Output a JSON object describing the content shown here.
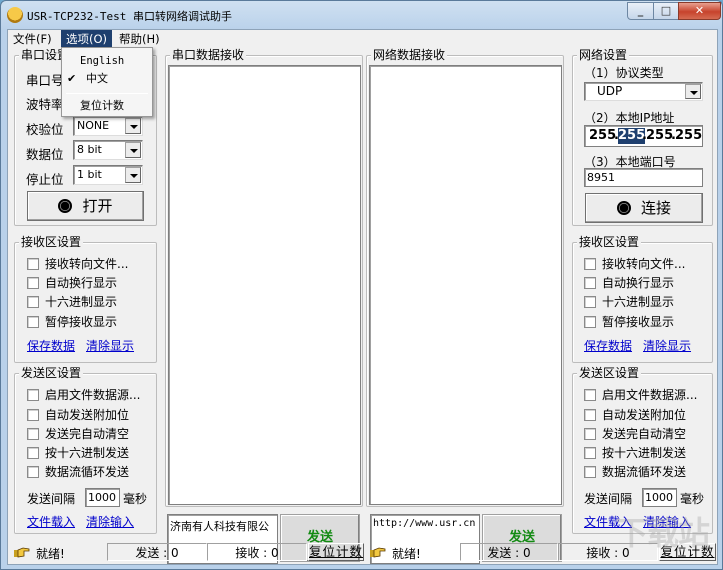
{
  "window": {
    "title": "USR-TCP232-Test  串口转网络调试助手",
    "controls": {
      "minimize": "_",
      "maximize": "□",
      "close": "✕"
    }
  },
  "menubar": {
    "items": [
      {
        "label": "文件(F)"
      },
      {
        "label": "选项(O)"
      },
      {
        "label": "帮助(H)"
      }
    ]
  },
  "options_menu": {
    "items": [
      {
        "label": "English",
        "checked": false
      },
      {
        "label": "中文",
        "checked": true,
        "check_glyph": "✔"
      },
      {
        "label": "复位计数",
        "checked": false
      }
    ]
  },
  "serial_settings": {
    "title": "串口设置",
    "port_label": "串口号",
    "baud_label": "波特率",
    "parity_label": "校验位",
    "parity_value": "NONE",
    "databits_label": "数据位",
    "databits_value": "8 bit",
    "stopbits_label": "停止位",
    "stopbits_value": "1 bit",
    "open_button": "打开"
  },
  "left_receive_settings": {
    "title": "接收区设置",
    "options": [
      "接收转向文件...",
      "自动换行显示",
      "十六进制显示",
      "暂停接收显示"
    ],
    "save_link": "保存数据",
    "clear_link": "清除显示"
  },
  "left_send_settings": {
    "title": "发送区设置",
    "options": [
      "启用文件数据源...",
      "自动发送附加位",
      "发送完自动清空",
      "按十六进制发送",
      "数据流循环发送"
    ],
    "interval_label": "发送间隔",
    "interval_value": "1000",
    "interval_unit": "毫秒",
    "load_link": "文件载入",
    "clear_link": "清除输入"
  },
  "serial_receive": {
    "title": "串口数据接收",
    "content": ""
  },
  "serial_send": {
    "text": "济南有人科技有限公",
    "send_button": "发送"
  },
  "network_receive": {
    "title": "网络数据接收",
    "content": ""
  },
  "network_send": {
    "text": "http://www.usr.cn",
    "send_button": "发送"
  },
  "network_settings": {
    "title": "网络设置",
    "protocol_label": "（1）协议类型",
    "protocol_value": "UDP",
    "ip_label": "（2）本地IP地址",
    "ip_segments": [
      "255",
      "255",
      "255",
      "255"
    ],
    "ip_selected_segment": 1,
    "port_label": "（3）本地端口号",
    "port_value": "8951",
    "connect_button": "连接"
  },
  "right_receive_settings": {
    "title": "接收区设置",
    "options": [
      "接收转向文件...",
      "自动换行显示",
      "十六进制显示",
      "暂停接收显示"
    ],
    "save_link": "保存数据",
    "clear_link": "清除显示"
  },
  "right_send_settings": {
    "title": "发送区设置",
    "options": [
      "启用文件数据源...",
      "自动发送附加位",
      "发送完自动清空",
      "按十六进制发送",
      "数据流循环发送"
    ],
    "interval_label": "发送间隔",
    "interval_value": "1000",
    "interval_unit": "毫秒",
    "load_link": "文件载入",
    "clear_link": "清除输入"
  },
  "status_left": {
    "ready": "就绪!",
    "sent": "发送 : 0",
    "received": "接收 : 0",
    "reset": "复位计数"
  },
  "status_right": {
    "ready": "就绪!",
    "sent": "发送 : 0",
    "received": "接收 : 0",
    "reset": "复位计数"
  },
  "watermark": "下载站"
}
